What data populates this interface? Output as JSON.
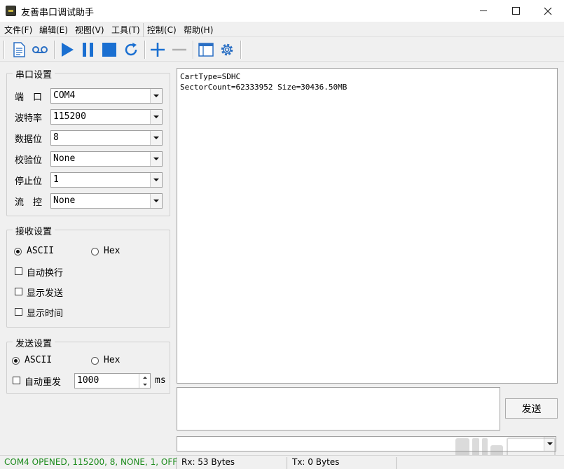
{
  "window": {
    "title": "友善串口调试助手"
  },
  "menu": [
    "文件(F)",
    "编辑(E)",
    "视图(V)",
    "工具(T)",
    "控制(C)",
    "帮助(H)"
  ],
  "toolbar": {
    "buttons": [
      "new-doc-icon",
      "record-icon",
      "play-icon",
      "pause-icon",
      "stop-icon",
      "refresh-icon",
      "add-icon",
      "remove-icon",
      "window-icon",
      "settings-icon"
    ],
    "colors": {
      "blue": "#1a6fd1"
    }
  },
  "serial": {
    "title": "串口设置",
    "fields": [
      {
        "label": "端　口",
        "value": "COM4"
      },
      {
        "label": "波特率",
        "value": "115200"
      },
      {
        "label": "数据位",
        "value": "8"
      },
      {
        "label": "校验位",
        "value": "None"
      },
      {
        "label": "停止位",
        "value": "1"
      },
      {
        "label": "流　控",
        "value": "None"
      }
    ]
  },
  "receive": {
    "title": "接收设置",
    "ascii": "ASCII",
    "hex": "Hex",
    "auto_newline": "自动换行",
    "show_send": "显示发送",
    "show_time": "显示时间"
  },
  "send": {
    "title": "发送设置",
    "ascii": "ASCII",
    "hex": "Hex",
    "auto_resend": "自动重发",
    "interval": "1000",
    "unit": "ms",
    "button": "发送"
  },
  "output": {
    "lines": [
      "CartType=SDHC",
      "SectorCount=62333952 Size=30436.50MB"
    ]
  },
  "status": {
    "port": "COM4 OPENED, 115200, 8, NONE, 1, OFF",
    "rx": "Rx: 53 Bytes",
    "tx": "Tx: 0 Bytes",
    "port_color": "#1a8a1a"
  }
}
